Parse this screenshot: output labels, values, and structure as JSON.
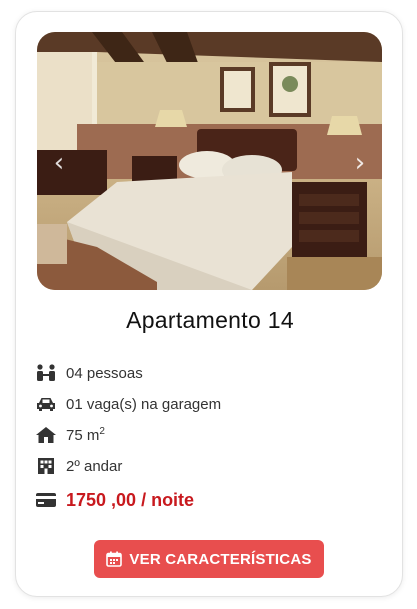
{
  "carousel": {
    "image_alt": "Quarto com cama de casal, mesas de cabeceira, abajures e quadros na parede",
    "prev_glyph": "‹",
    "next_glyph": "›"
  },
  "listing": {
    "title": "Apartamento 14",
    "features": [
      {
        "icon": "people-icon",
        "text": "04 pessoas"
      },
      {
        "icon": "car-icon",
        "text": "01 vaga(s) na garagem"
      },
      {
        "icon": "house-icon",
        "text": "75 m",
        "sup": "2"
      },
      {
        "icon": "building-icon",
        "text": "2º andar"
      }
    ],
    "price": {
      "icon": "credit-card-icon",
      "text": "1750 ,00 / noite"
    },
    "cta": {
      "icon": "calendar-icon",
      "label": "VER CARACTERÍSTICAS"
    }
  },
  "colors": {
    "accent": "#e84e4e",
    "price": "#c8191e",
    "icon": "#333333"
  }
}
